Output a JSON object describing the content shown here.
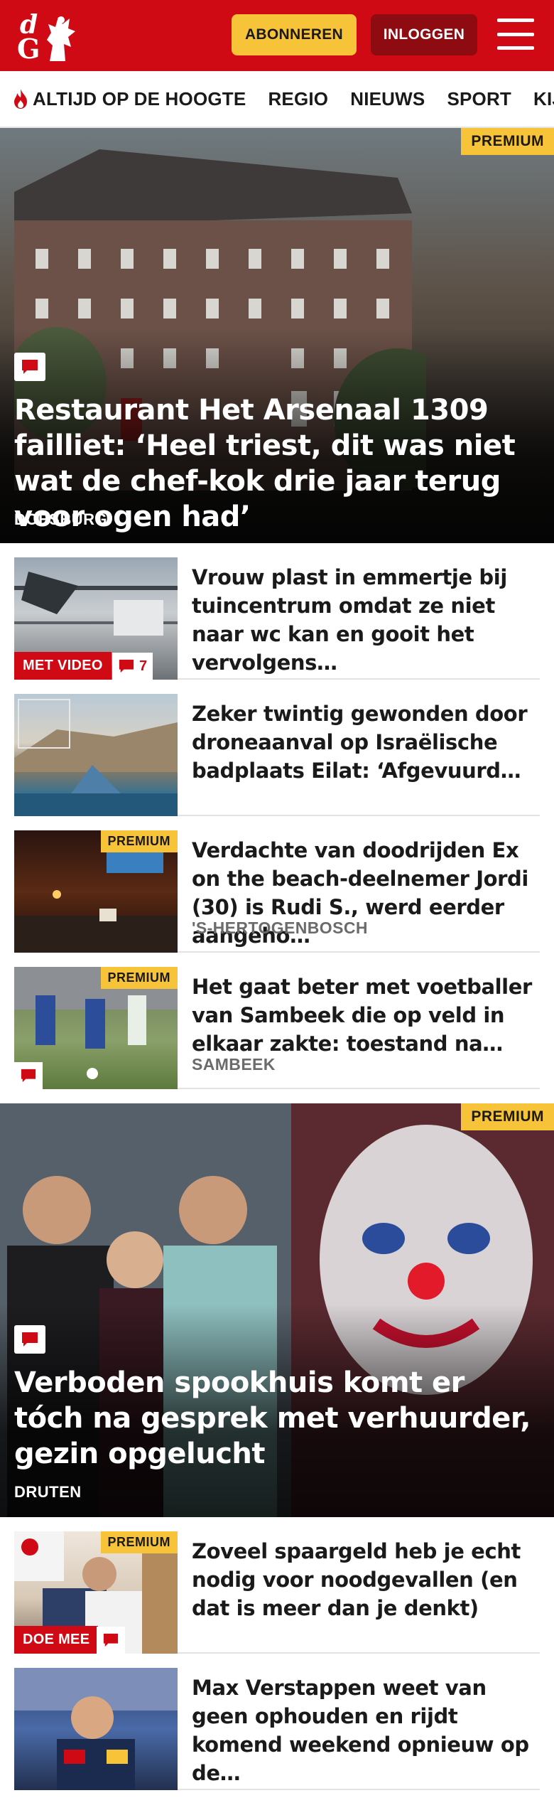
{
  "header": {
    "logo_text_d": "d",
    "logo_text_g": "G",
    "subscribe_label": "ABONNEREN",
    "login_label": "INLOGGEN"
  },
  "nav": {
    "items": [
      {
        "label": "ALTIJD OP DE HOOGTE"
      },
      {
        "label": "REGIO"
      },
      {
        "label": "NIEUWS"
      },
      {
        "label": "SPORT"
      },
      {
        "label": "KIJK"
      }
    ]
  },
  "hero1": {
    "badge": "PREMIUM",
    "headline": "Restaurant Het Arsenaal 1309 failliet: ‘Heel triest, dit was niet wat de chef-kok drie jaar terug voor ogen had’",
    "place": "DOESBURG"
  },
  "articles_a": [
    {
      "title": "Vrouw plast in emmertje bij tuincentrum omdat ze niet naar wc kan en gooit het vervolgens…",
      "video_label": "MET VIDEO",
      "comments": "7"
    },
    {
      "title": "Zeker twintig gewonden door droneaanval op Israëlische badplaats Eilat: ‘Afgevuurd…"
    },
    {
      "title": "Verdachte van doodrijden Ex on the beach-deelnemer Jordi (30) is Rudi S., werd eerder aangeho…",
      "badge": "PREMIUM",
      "place": "'S-HERTOGENBOSCH"
    },
    {
      "title": "Het gaat beter met voetballer van Sambeek die op veld in elkaar zakte: toestand na…",
      "badge": "PREMIUM",
      "place": "SAMBEEK"
    }
  ],
  "hero2": {
    "badge": "PREMIUM",
    "headline": "Verboden spookhuis komt er tóch na gesprek met verhuurder, gezin opgelucht",
    "place": "DRUTEN"
  },
  "articles_b": [
    {
      "title": "Zoveel spaargeld heb je echt nodig voor noodgevallen (en dat is meer dan je denkt)",
      "badge": "PREMIUM",
      "action_label": "DOE MEE"
    },
    {
      "title": "Max Verstappen weet van geen ophouden en rijdt komend weekend opnieuw op de…"
    }
  ],
  "colors": {
    "brand_red": "#cf0a14",
    "premium_yellow": "#f7c338",
    "login_dark_red": "#8f0b12"
  },
  "icons": [
    "flame-icon",
    "comment-icon",
    "hamburger-menu-icon",
    "logo-knight-icon"
  ]
}
